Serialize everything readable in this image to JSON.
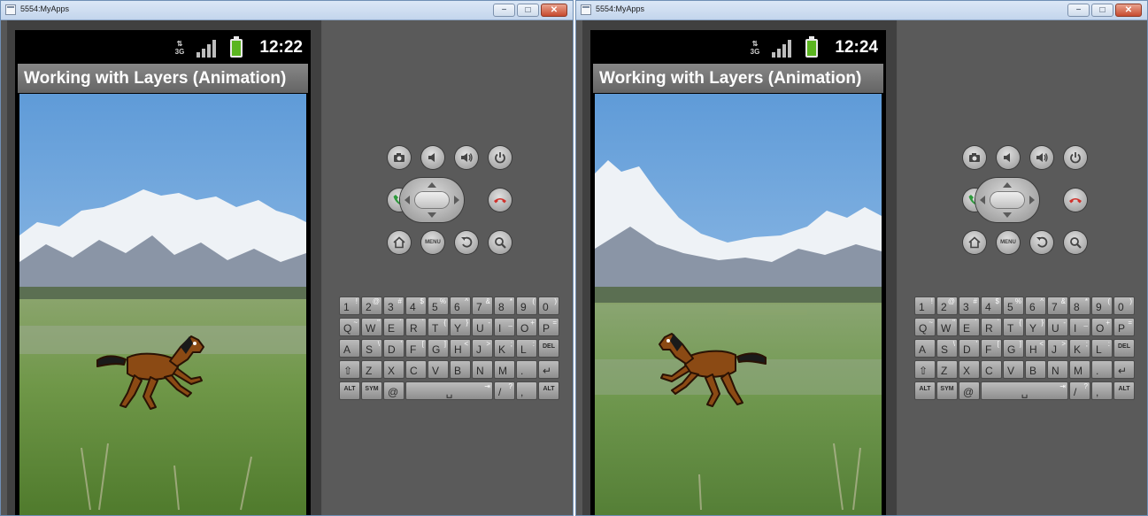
{
  "windows": [
    {
      "title": "5554:MyApps",
      "status_bar": {
        "network": "3G",
        "clock": "12:22"
      },
      "app_title": "Working with Layers (Animation)",
      "sprite": {
        "facing": "left"
      }
    },
    {
      "title": "5554:MyApps",
      "status_bar": {
        "network": "3G",
        "clock": "12:24"
      },
      "app_title": "Working with Layers (Animation)",
      "sprite": {
        "facing": "right"
      }
    }
  ],
  "window_buttons": {
    "minimize": "−",
    "maximize": "□",
    "close": "✕"
  },
  "hardware_buttons": {
    "row1": [
      "camera-icon",
      "volume-down-icon",
      "volume-up-icon",
      "power-icon"
    ],
    "row2": [
      "call-icon",
      "dpad",
      "end-call-icon"
    ],
    "row3": [
      "home-icon",
      "menu-icon",
      "back-icon",
      "search-icon"
    ],
    "menu_label": "MENU"
  },
  "keyboard": {
    "rows": [
      [
        [
          "1",
          "!"
        ],
        [
          "2",
          "@"
        ],
        [
          "3",
          "#"
        ],
        [
          "4",
          "$"
        ],
        [
          "5",
          "%"
        ],
        [
          "6",
          "^"
        ],
        [
          "7",
          "&"
        ],
        [
          "8",
          "*"
        ],
        [
          "9",
          "("
        ],
        [
          "0",
          ")"
        ]
      ],
      [
        [
          "Q",
          "~"
        ],
        [
          "W",
          "\""
        ],
        [
          "E",
          "´"
        ],
        [
          "R",
          "`"
        ],
        [
          "T",
          "{"
        ],
        [
          "Y",
          "}"
        ],
        [
          "U",
          "-"
        ],
        [
          "I",
          "_"
        ],
        [
          "O",
          "+"
        ],
        [
          "P",
          "="
        ]
      ],
      [
        [
          "A",
          ""
        ],
        [
          "S",
          "\\"
        ],
        [
          "D",
          "'"
        ],
        [
          "F",
          "["
        ],
        [
          "G",
          "]"
        ],
        [
          "H",
          "<"
        ],
        [
          "J",
          ">"
        ],
        [
          "K",
          ";"
        ],
        [
          "L",
          ":"
        ],
        [
          "DEL",
          ""
        ]
      ],
      [
        [
          "⇧",
          ""
        ],
        [
          "Z",
          ""
        ],
        [
          "X",
          ""
        ],
        [
          "C",
          ""
        ],
        [
          "V",
          ""
        ],
        [
          "B",
          ""
        ],
        [
          "N",
          ""
        ],
        [
          "M",
          ""
        ],
        [
          ".",
          ""
        ],
        [
          "↵",
          ""
        ]
      ],
      [
        [
          "ALT",
          ""
        ],
        [
          "SYM",
          ""
        ],
        [
          "@",
          ""
        ],
        [
          "␣",
          "⇥"
        ],
        [
          "/",
          "?"
        ],
        [
          ",",
          ""
        ],
        [
          "ALT",
          ""
        ]
      ]
    ]
  },
  "colors": {
    "call": "#2e9a3c",
    "end_call": "#d0312b",
    "sky": "#6fa6da",
    "grass": "#5f8a3a",
    "horse": "#8b4a14"
  }
}
